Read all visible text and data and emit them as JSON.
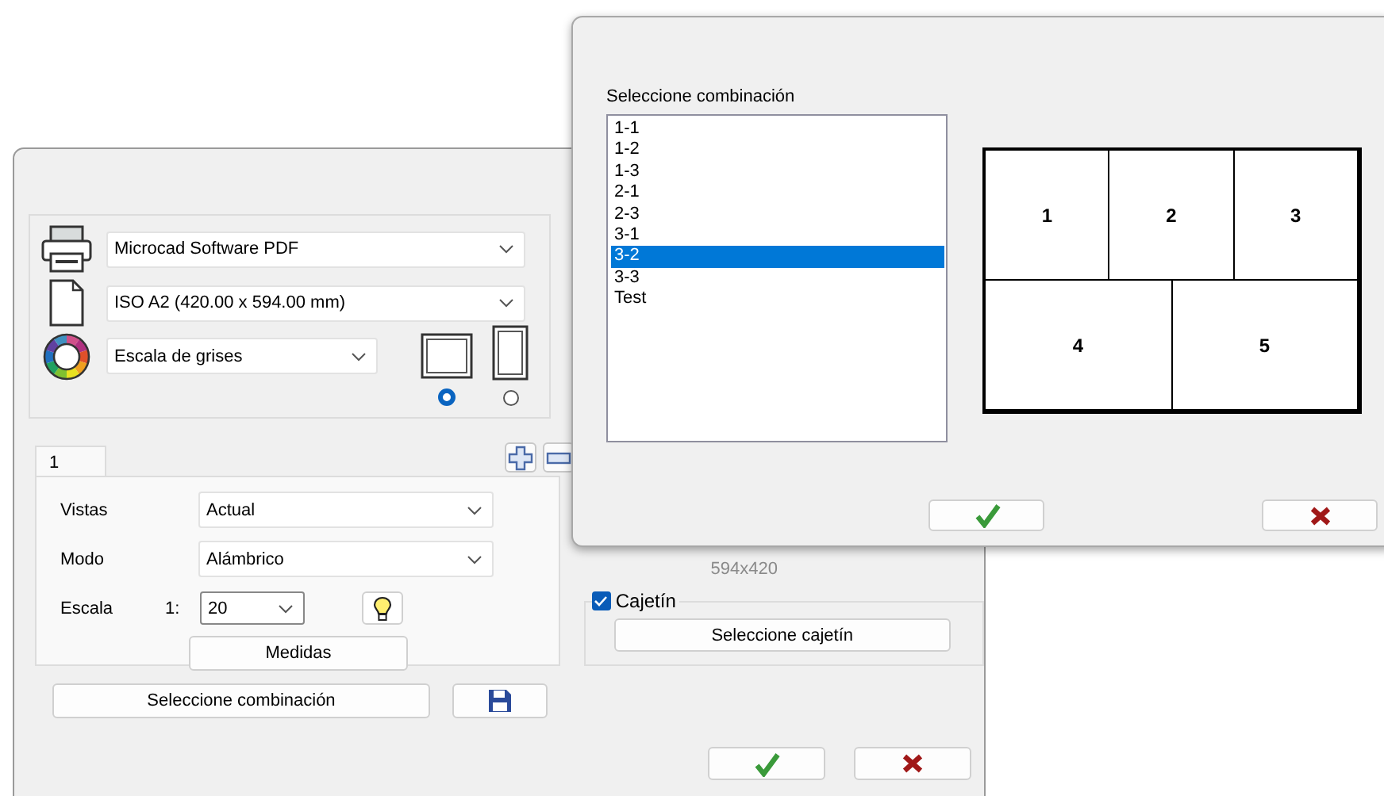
{
  "main_dialog": {
    "printer": {
      "value": "Microcad Software PDF"
    },
    "paper": {
      "value": "ISO A2 (420.00 x 594.00 mm)"
    },
    "color_mode": {
      "value": "Escala de grises"
    },
    "orientations": [
      {
        "kind": "landscape",
        "selected": true
      },
      {
        "kind": "portrait",
        "selected": false
      }
    ],
    "tabs": [
      {
        "label": "1",
        "selected": true
      }
    ],
    "view_fields": [
      {
        "label": "Vistas",
        "value": "Actual"
      },
      {
        "label": "Modo",
        "value": "Alámbrico"
      }
    ],
    "scale": {
      "label": "Escala",
      "prefix": "1:",
      "value": "20"
    },
    "measures_button": "Medidas",
    "combination_button": "Seleccione combinación",
    "page_size": "594x420",
    "title_block": {
      "label": "Cajetín",
      "checked": true,
      "button": "Seleccione cajetín"
    }
  },
  "combination_dialog": {
    "list_label": "Seleccione combinación",
    "items": [
      {
        "label": "1-1",
        "selected": false
      },
      {
        "label": "1-2",
        "selected": false
      },
      {
        "label": "1-3",
        "selected": false
      },
      {
        "label": "2-1",
        "selected": false
      },
      {
        "label": "2-3",
        "selected": false
      },
      {
        "label": "3-1",
        "selected": false
      },
      {
        "label": "3-2",
        "selected": true
      },
      {
        "label": "3-3",
        "selected": false
      },
      {
        "label": "Test",
        "selected": false
      }
    ],
    "preview": {
      "rows": [
        [
          "1",
          "2",
          "3"
        ],
        [
          "4",
          "5"
        ]
      ]
    }
  }
}
